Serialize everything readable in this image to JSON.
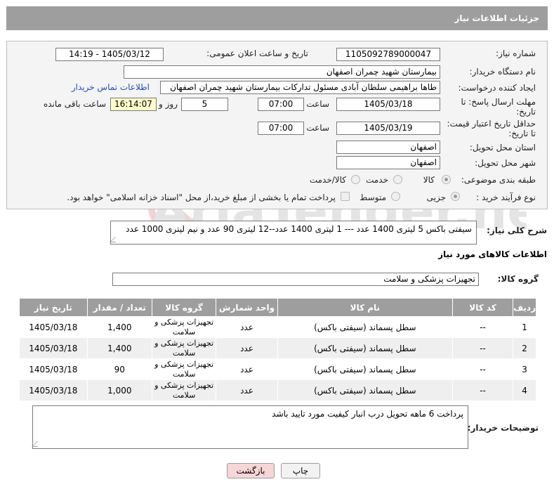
{
  "title": "جزئیات اطلاعات نیاز",
  "fields": {
    "need_number_label": "شماره نیاز:",
    "need_number": "1105092789000047",
    "announce_label": "تاریخ و ساعت اعلان عمومی:",
    "announce_value": "1405/03/12 - 14:19",
    "buyer_org_label": "نام دستگاه خریدار:",
    "buyer_org": "بیمارستان شهید چمران اصفهان",
    "creator_label": "ایجاد کننده درخواست:",
    "creator": "طاها براهیمی سلطان آبادی مسئول تدارکات  بیمارستان شهید چمران اصفهان",
    "contact_link": "اطلاعات تماس خریدار",
    "deadline_label_1": "مهلت ارسال پاسخ: تا",
    "deadline_label_2": "تاریخ:",
    "deadline_date": "1405/03/18",
    "time_label": "ساعت",
    "deadline_time": "07:00",
    "days_value": "5",
    "days_label": "روز و",
    "remaining_time": "16:14:07",
    "remaining_label": "ساعت باقی مانده",
    "validity_label_1": "حداقل تاریخ اعتبار قیمت:",
    "validity_label_2": "تا تاریخ:",
    "validity_date": "1405/03/19",
    "validity_time": "07:00",
    "province_label": "استان محل تحویل:",
    "province": "اصفهان",
    "city_label": "شهر محل تحویل:",
    "city": "اصفهان",
    "category_label": "طبقه بندی موضوعی:",
    "category_options": [
      "کالا",
      "خدمت",
      "کالا/خدمت"
    ],
    "process_label": "نوع فرآیند خرید :",
    "process_options": [
      "جزیی",
      "متوسط"
    ],
    "payment_note": "پرداخت تمام یا بخشی از مبلغ خرید،از محل \"اسناد خزانه اسلامی\" خواهد بود."
  },
  "summary": {
    "label": "شرح کلی نیاز:",
    "text": "سیفتی باکس 5 لیتری 1400 عدد --- 1 لیتری 1400 عدد--12 لیتری 90 عدد و نیم لیتری 1000 عدد"
  },
  "goods_section": {
    "heading": "اطلاعات کالاهای مورد نیاز",
    "group_label": "گروه کالا:",
    "group_value": "تجهیزات پزشکی و سلامت"
  },
  "table": {
    "headers": [
      "ردیف",
      "کد کالا",
      "نام کالا",
      "واحد شمارش",
      "گروه کالا",
      "تعداد / مقدار",
      "تاریخ نیاز"
    ],
    "rows": [
      {
        "row": "1",
        "code": "--",
        "name": "سطل پسماند (سیفتی باکس)",
        "unit": "عدد",
        "group": "تجهیزات پزشکی و سلامت",
        "qty": "1,400",
        "date": "1405/03/18"
      },
      {
        "row": "2",
        "code": "--",
        "name": "سطل پسماند (سیفتی باکس)",
        "unit": "عدد",
        "group": "تجهیزات پزشکی و سلامت",
        "qty": "1,400",
        "date": "1405/03/18"
      },
      {
        "row": "3",
        "code": "--",
        "name": "سطل پسماند (سیفتی باکس)",
        "unit": "عدد",
        "group": "تجهیزات پزشکی و سلامت",
        "qty": "90",
        "date": "1405/03/18"
      },
      {
        "row": "4",
        "code": "--",
        "name": "سطل پسماند (سیفتی باکس)",
        "unit": "عدد",
        "group": "تجهیزات پزشکی و سلامت",
        "qty": "1,000",
        "date": "1405/03/18"
      }
    ]
  },
  "buyer_notes": {
    "label": "توضیحات خریدار:",
    "text": "پرداخت 6 ماهه تحویل درب انبار کیفیت مورد تایید باشد"
  },
  "buttons": {
    "print": "چاپ",
    "back": "بازگشت"
  },
  "watermark": "AriaTender.net",
  "colors": {
    "header_gray": "#9e9e9e",
    "link_blue": "#1f4fbf",
    "highlight_yellow": "#ffffcc",
    "back_button_pink": "#f7d6d6"
  }
}
